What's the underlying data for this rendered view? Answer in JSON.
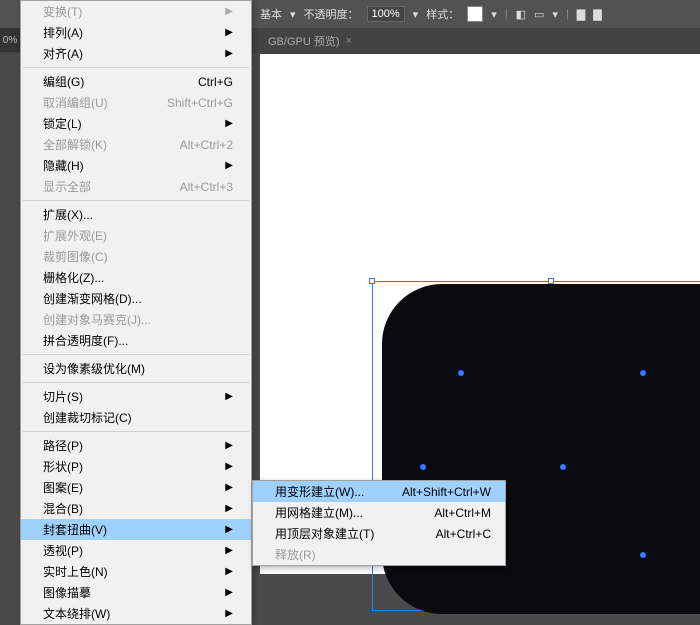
{
  "topbar": {
    "basic_label": "基本",
    "opacity_label": "不透明度：",
    "opacity_value": "100%",
    "style_label": "样式："
  },
  "tab": {
    "label": "GB/GPU 预览)"
  },
  "left_edge": "0%",
  "menu": {
    "items": [
      {
        "label": "变换(T)",
        "shortcut": "",
        "arrow": true,
        "disabled": true,
        "name": "transform"
      },
      {
        "label": "排列(A)",
        "shortcut": "",
        "arrow": true,
        "name": "arrange"
      },
      {
        "label": "对齐(A)",
        "shortcut": "",
        "arrow": true,
        "name": "align"
      },
      {
        "divider": true
      },
      {
        "label": "编组(G)",
        "shortcut": "Ctrl+G",
        "name": "group"
      },
      {
        "label": "取消编组(U)",
        "shortcut": "Shift+Ctrl+G",
        "disabled": true,
        "name": "ungroup"
      },
      {
        "label": "锁定(L)",
        "shortcut": "",
        "arrow": true,
        "name": "lock"
      },
      {
        "label": "全部解锁(K)",
        "shortcut": "Alt+Ctrl+2",
        "disabled": true,
        "name": "unlock-all"
      },
      {
        "label": "隐藏(H)",
        "shortcut": "",
        "arrow": true,
        "name": "hide"
      },
      {
        "label": "显示全部",
        "shortcut": "Alt+Ctrl+3",
        "disabled": true,
        "name": "show-all"
      },
      {
        "divider": true
      },
      {
        "label": "扩展(X)...",
        "shortcut": "",
        "name": "expand"
      },
      {
        "label": "扩展外观(E)",
        "shortcut": "",
        "disabled": true,
        "name": "expand-appearance"
      },
      {
        "label": "裁剪图像(C)",
        "shortcut": "",
        "disabled": true,
        "name": "crop-image"
      },
      {
        "label": "栅格化(Z)...",
        "shortcut": "",
        "name": "rasterize"
      },
      {
        "label": "创建渐变网格(D)...",
        "shortcut": "",
        "name": "create-gradient-mesh"
      },
      {
        "label": "创建对象马赛克(J)...",
        "shortcut": "",
        "disabled": true,
        "name": "create-mosaic"
      },
      {
        "label": "拼合透明度(F)...",
        "shortcut": "",
        "name": "flatten-transparency"
      },
      {
        "divider": true
      },
      {
        "label": "设为像素级优化(M)",
        "shortcut": "",
        "name": "pixel-perfect"
      },
      {
        "divider": true
      },
      {
        "label": "切片(S)",
        "shortcut": "",
        "arrow": true,
        "name": "slice"
      },
      {
        "label": "创建裁切标记(C)",
        "shortcut": "",
        "name": "trim-marks"
      },
      {
        "divider": true
      },
      {
        "label": "路径(P)",
        "shortcut": "",
        "arrow": true,
        "name": "path"
      },
      {
        "label": "形状(P)",
        "shortcut": "",
        "arrow": true,
        "name": "shape"
      },
      {
        "label": "图案(E)",
        "shortcut": "",
        "arrow": true,
        "name": "pattern"
      },
      {
        "label": "混合(B)",
        "shortcut": "",
        "arrow": true,
        "name": "blend"
      },
      {
        "label": "封套扭曲(V)",
        "shortcut": "",
        "arrow": true,
        "hovered": true,
        "name": "envelope-distort"
      },
      {
        "label": "透视(P)",
        "shortcut": "",
        "arrow": true,
        "name": "perspective"
      },
      {
        "label": "实时上色(N)",
        "shortcut": "",
        "arrow": true,
        "name": "live-paint"
      },
      {
        "label": "图像描摹",
        "shortcut": "",
        "arrow": true,
        "name": "image-trace"
      },
      {
        "label": "文本绕排(W)",
        "shortcut": "",
        "arrow": true,
        "name": "text-wrap"
      }
    ]
  },
  "submenu": {
    "items": [
      {
        "label": "用变形建立(W)...",
        "shortcut": "Alt+Shift+Ctrl+W",
        "hovered": true,
        "name": "make-with-warp"
      },
      {
        "label": "用网格建立(M)...",
        "shortcut": "Alt+Ctrl+M",
        "name": "make-with-mesh"
      },
      {
        "label": "用顶层对象建立(T)",
        "shortcut": "Alt+Ctrl+C",
        "name": "make-with-top"
      },
      {
        "label": "释放(R)",
        "shortcut": "",
        "disabled": true,
        "name": "release"
      }
    ]
  }
}
